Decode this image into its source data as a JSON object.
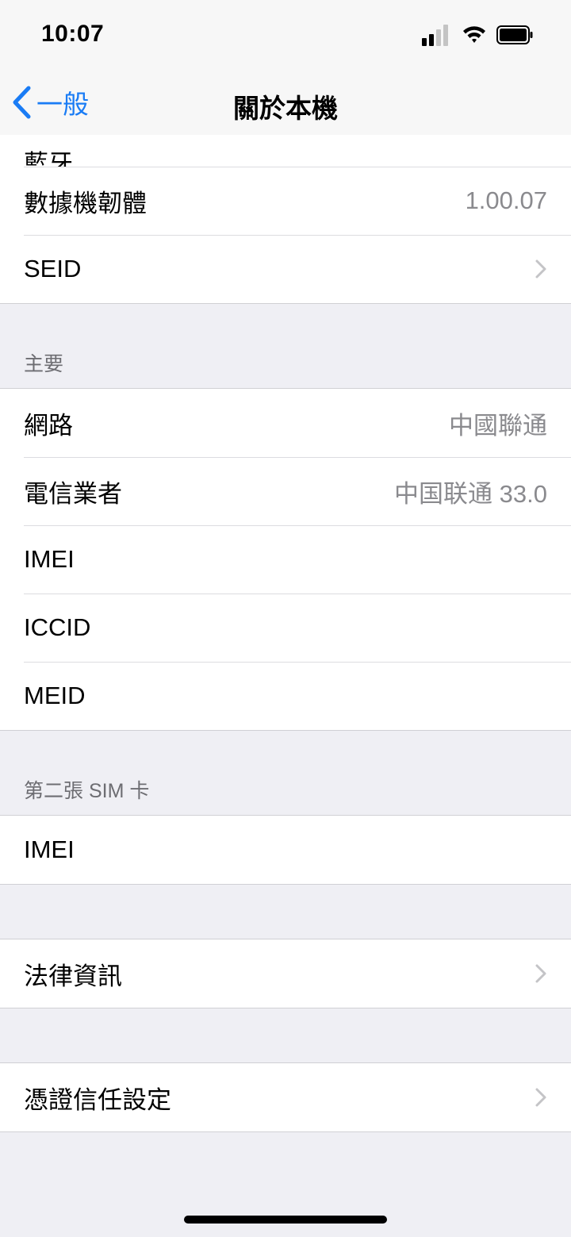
{
  "status": {
    "time": "10:07"
  },
  "nav": {
    "back_label": "一般",
    "title": "關於本機"
  },
  "top_rows": [
    {
      "label": "藍牙",
      "value": ""
    },
    {
      "label": "數據機韌體",
      "value": "1.00.07"
    },
    {
      "label": "SEID",
      "value": ""
    }
  ],
  "primary": {
    "header": "主要",
    "rows": [
      {
        "label": "網路",
        "value": "中國聯通"
      },
      {
        "label": "電信業者",
        "value": "中国联通 33.0"
      },
      {
        "label": "IMEI",
        "value": ""
      },
      {
        "label": "ICCID",
        "value": ""
      },
      {
        "label": "MEID",
        "value": ""
      }
    ]
  },
  "secondary": {
    "header": "第二張 SIM 卡",
    "rows": [
      {
        "label": "IMEI",
        "value": ""
      }
    ]
  },
  "legal": {
    "label": "法律資訊"
  },
  "trust": {
    "label": "憑證信任設定"
  },
  "colors": {
    "accent": "#1a7cf5",
    "secondary_text": "#8a8a8e",
    "background": "#efeff4"
  }
}
